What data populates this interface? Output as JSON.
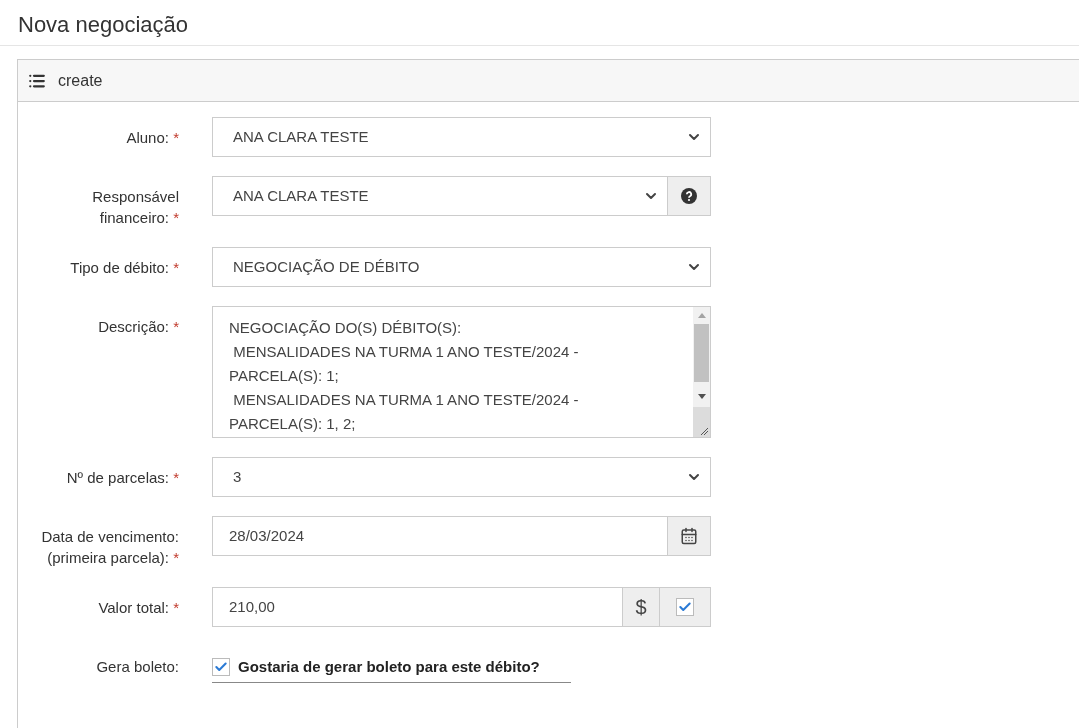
{
  "page_title": "Nova negociação",
  "panel": {
    "title": "create"
  },
  "fields": [
    {
      "kind": "select",
      "label": "Aluno:",
      "required_mark": "*",
      "value": "ANA CLARA TESTE"
    },
    {
      "kind": "select_help",
      "label": "Responsável financeiro:",
      "required_mark": "*",
      "value": "ANA CLARA TESTE"
    },
    {
      "kind": "select",
      "label": "Tipo de débito:",
      "required_mark": "*",
      "value": "NEGOCIAÇÃO DE DÉBITO"
    },
    {
      "kind": "textarea",
      "label": "Descrição:",
      "required_mark": "*",
      "lines": [
        "NEGOCIAÇÃO DO(S) DÉBITO(S):",
        " MENSALIDADES NA TURMA 1 ANO TESTE/2024 -",
        "PARCELA(S): 1;",
        " MENSALIDADES NA TURMA 1 ANO TESTE/2024 -",
        "PARCELA(S): 1, 2;"
      ]
    },
    {
      "kind": "select",
      "label": "Nº de parcelas:",
      "required_mark": "*",
      "value": "3"
    },
    {
      "kind": "date",
      "label": "Data de vencimento: (primeira parcela):",
      "required_mark": "*",
      "value": "28/03/2024"
    },
    {
      "kind": "money",
      "label": "Valor total:",
      "required_mark": "*",
      "value": "210,00",
      "addon": "$",
      "checked": true
    },
    {
      "kind": "checkbox",
      "label": "Gera boleto:",
      "text": "Gostaria de gerar boleto para este débito?",
      "checked": true
    }
  ]
}
